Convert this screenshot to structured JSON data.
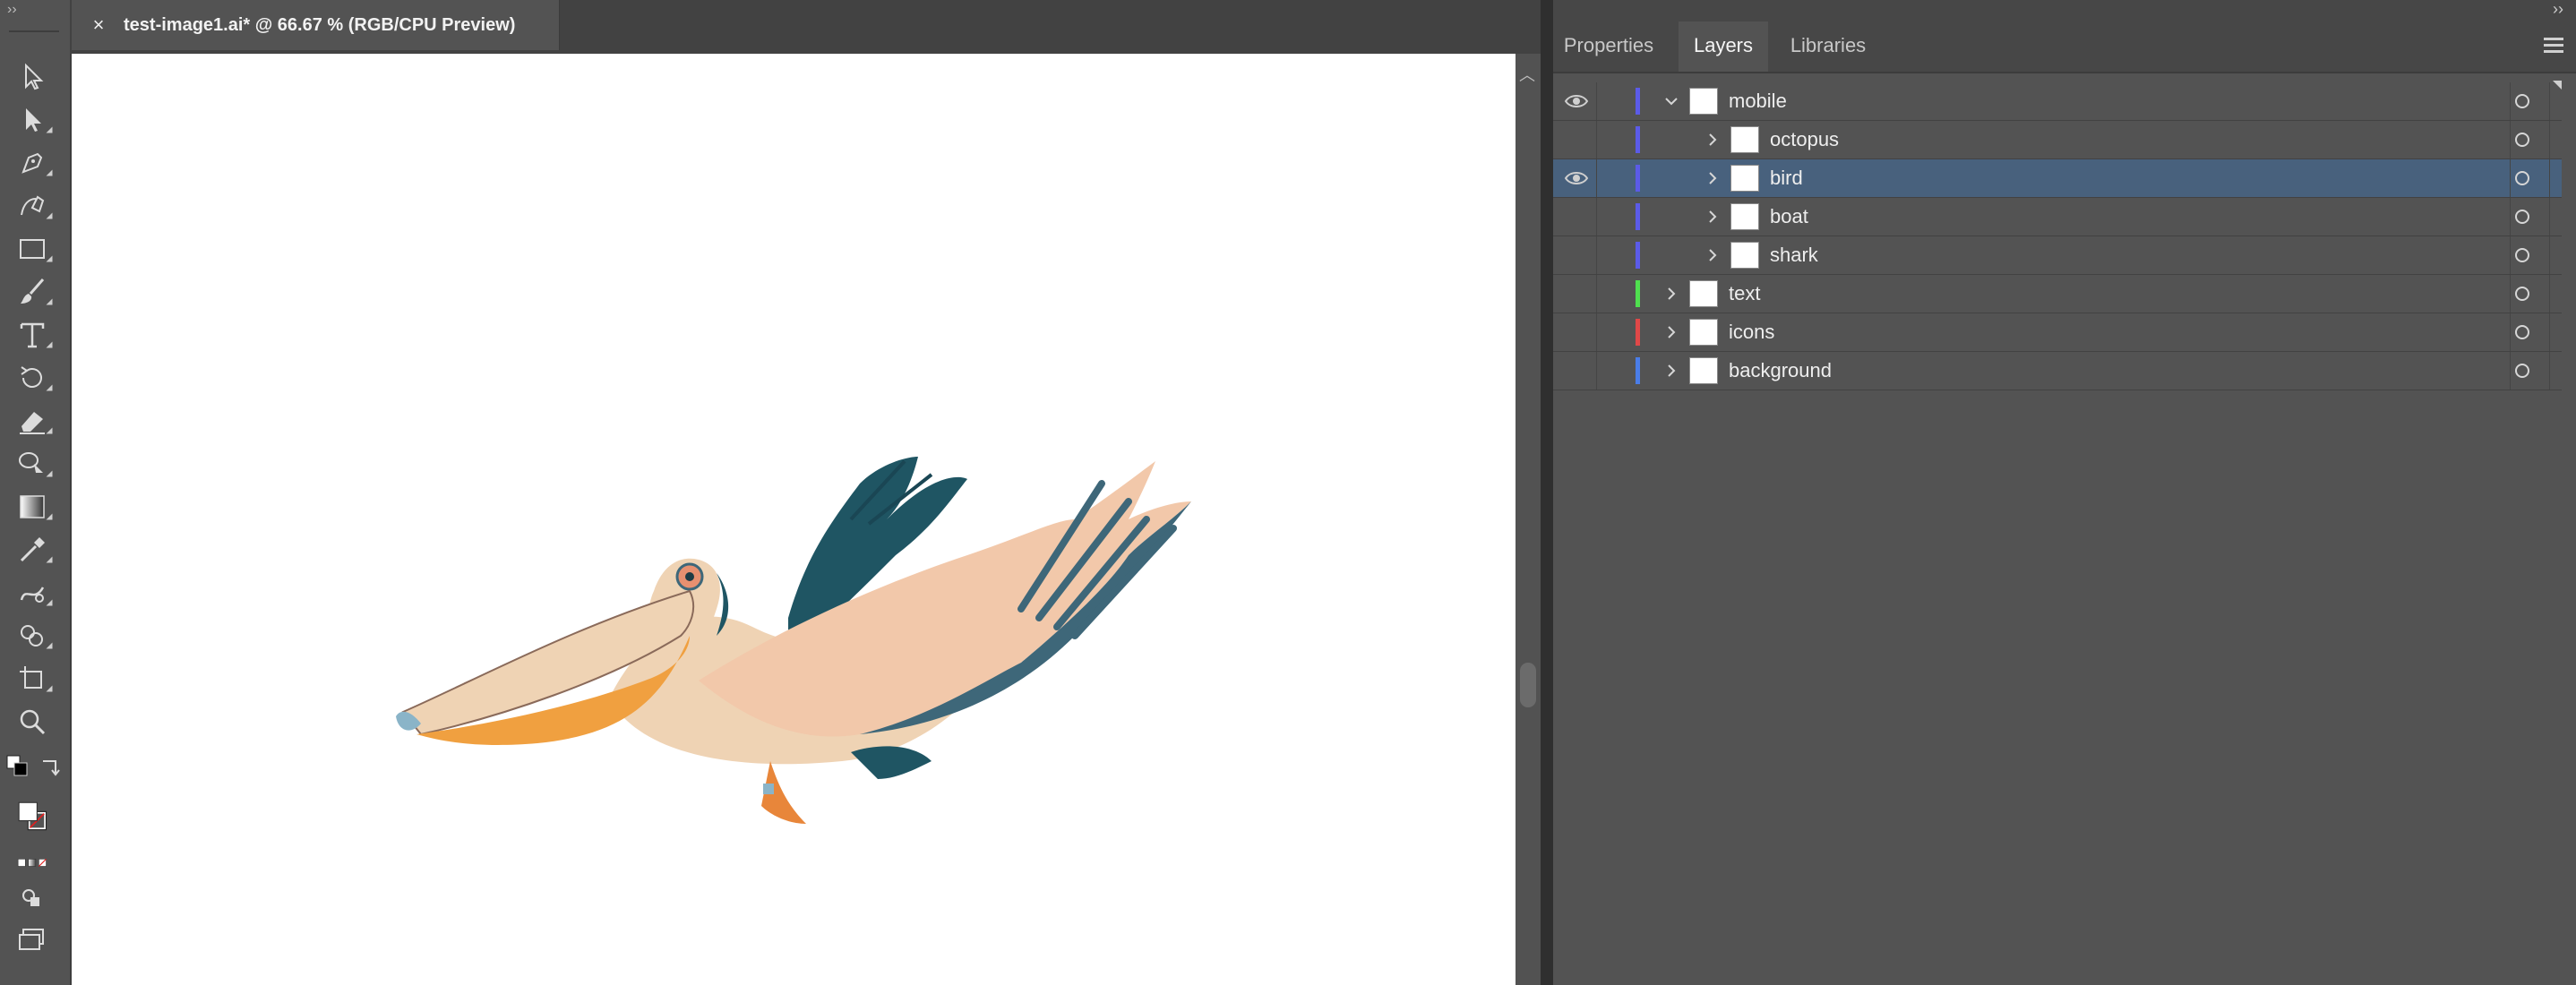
{
  "document": {
    "tab_title": "test-image1.ai* @ 66.67 % (RGB/CPU Preview)",
    "close_glyph": "×"
  },
  "toolbar": {
    "grip": "››",
    "tools": [
      "selection-tool",
      "direct-selection-tool",
      "pen-tool",
      "curvature-tool",
      "rectangle-tool",
      "paintbrush-tool",
      "type-tool",
      "rotate-tool",
      "eraser-tool",
      "puppet-warp-tool",
      "gradient-tool",
      "eyedropper-tool",
      "blend-tool",
      "shape-builder-tool",
      "artboard-tool",
      "zoom-tool"
    ]
  },
  "panel": {
    "collapse_glyph": "››",
    "tabs": [
      {
        "label": "Properties",
        "active": false
      },
      {
        "label": "Layers",
        "active": true
      },
      {
        "label": "Libraries",
        "active": false
      }
    ]
  },
  "layers": [
    {
      "name": "mobile",
      "visible": true,
      "expanded": true,
      "indent": 0,
      "color": "#5b5be8",
      "selected": false
    },
    {
      "name": "octopus",
      "visible": false,
      "expanded": false,
      "indent": 1,
      "color": "#5b5be8",
      "selected": false
    },
    {
      "name": "bird",
      "visible": true,
      "expanded": false,
      "indent": 1,
      "color": "#5b5be8",
      "selected": true
    },
    {
      "name": "boat",
      "visible": false,
      "expanded": false,
      "indent": 1,
      "color": "#5b5be8",
      "selected": false
    },
    {
      "name": "shark",
      "visible": false,
      "expanded": false,
      "indent": 1,
      "color": "#5b5be8",
      "selected": false
    },
    {
      "name": "text",
      "visible": false,
      "expanded": false,
      "indent": 0,
      "color": "#4fe04f",
      "selected": false
    },
    {
      "name": "icons",
      "visible": false,
      "expanded": false,
      "indent": 0,
      "color": "#e04848",
      "selected": false
    },
    {
      "name": "background",
      "visible": false,
      "expanded": false,
      "indent": 0,
      "color": "#4a7de8",
      "selected": false
    }
  ],
  "colors": {
    "pelican_bill": "#f0a040",
    "pelican_body": "#efd3b4",
    "wing_dark": "#3e6779",
    "wing_teal": "#1f5563"
  }
}
